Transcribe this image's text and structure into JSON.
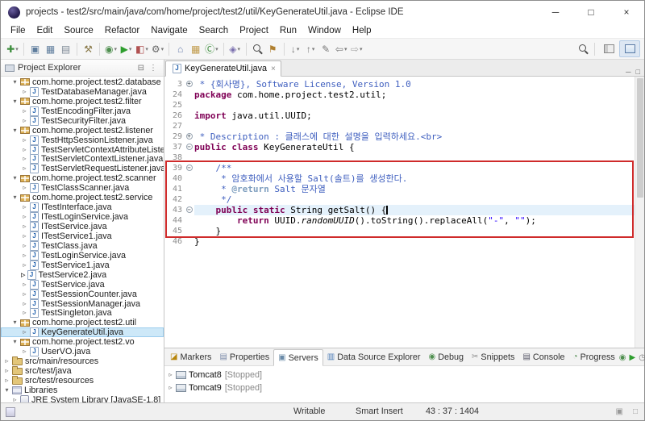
{
  "window": {
    "title": "projects - test2/src/main/java/com/home/project/test2/util/KeyGenerateUtil.java - Eclipse IDE",
    "controls": {
      "minimize": "─",
      "maximize": "□",
      "close": "×"
    }
  },
  "menubar": {
    "items": [
      "File",
      "Edit",
      "Source",
      "Refactor",
      "Navigate",
      "Search",
      "Project",
      "Run",
      "Window",
      "Help"
    ]
  },
  "icons": {
    "dropdown": "▾",
    "chevron_right": "▹",
    "chevron_down": "▾",
    "close": "×",
    "java_badge": "J",
    "fold_plus": "+",
    "fold_minus": "−",
    "collapse_all": "⊟",
    "view_menu": "⋮",
    "minimize": "─",
    "maximize": "□",
    "status_right_1": "▣",
    "status_right_2": "□"
  },
  "toolbar": {
    "buttons": [
      {
        "name": "new-wizard",
        "glyph": "✚",
        "color": "#3e8e3e"
      },
      {
        "name": "save",
        "glyph": "▣",
        "color": "#5f7d9d"
      },
      {
        "name": "save-all",
        "glyph": "▦",
        "color": "#5f7d9d"
      },
      {
        "name": "print",
        "glyph": "▤",
        "color": "#7f8a96"
      },
      {
        "name": "build-all",
        "glyph": "⚒",
        "color": "#8a7a4a"
      },
      {
        "name": "debug",
        "glyph": "◉",
        "color": "#4f8f4f"
      },
      {
        "name": "run",
        "glyph": "▶",
        "color": "#2e9e2e"
      },
      {
        "name": "coverage",
        "glyph": "◧",
        "color": "#b05050"
      },
      {
        "name": "external-tools",
        "glyph": "⚙",
        "color": "#666666"
      },
      {
        "name": "new-java-project",
        "glyph": "⌂",
        "color": "#6a7fae"
      },
      {
        "name": "new-package",
        "glyph": "▦",
        "color": "#c09a4a"
      },
      {
        "name": "new-class",
        "glyph": "Ⓒ",
        "color": "#3f8f3f"
      },
      {
        "name": "new-servlet",
        "glyph": "◈",
        "color": "#7a6fae"
      },
      {
        "name": "search",
        "glyph": "",
        "color": "#444444"
      },
      {
        "name": "mark-occurrences",
        "glyph": "⚑",
        "color": "#b08030"
      },
      {
        "name": "next-annotation",
        "glyph": "↓",
        "color": "#777777"
      },
      {
        "name": "prev-annotation",
        "glyph": "↑",
        "color": "#777777"
      },
      {
        "name": "last-edit-location",
        "glyph": "✎",
        "color": "#777777"
      },
      {
        "name": "back",
        "glyph": "⇦",
        "color": "#777777"
      },
      {
        "name": "forward",
        "glyph": "⇨",
        "color": "#aaaaaa"
      }
    ]
  },
  "explorer": {
    "title": "Project Explorer",
    "items": [
      {
        "label": "com.home.project.test2.database"
      },
      {
        "label": "TestDatabaseManager.java"
      },
      {
        "label": "com.home.project.test2.filter"
      },
      {
        "label": "TestEncodingFilter.java"
      },
      {
        "label": "TestSecurityFilter.java"
      },
      {
        "label": "com.home.project.test2.listener"
      },
      {
        "label": "TestHttpSessionListener.java"
      },
      {
        "label": "TestServletContextAttributeListener.java"
      },
      {
        "label": "TestServletContextListener.java"
      },
      {
        "label": "TestServletRequestListener.java"
      },
      {
        "label": "com.home.project.test2.scanner"
      },
      {
        "label": "TestClassScanner.java"
      },
      {
        "label": "com.home.project.test2.service"
      },
      {
        "label": "ITestInterface.java"
      },
      {
        "label": "ITestLoginService.java"
      },
      {
        "label": "ITestService.java"
      },
      {
        "label": "ITestService1.java"
      },
      {
        "label": "TestClass.java"
      },
      {
        "label": "TestLoginService.java"
      },
      {
        "label": "TestService1.java"
      },
      {
        "label": "TestService2.java"
      },
      {
        "label": "TestService.java"
      },
      {
        "label": "TestSessionCounter.java"
      },
      {
        "label": "TestSessionManager.java"
      },
      {
        "label": "TestSingleton.java"
      },
      {
        "label": "com.home.project.test2.util"
      },
      {
        "label": "KeyGenerateUtil.java",
        "selected": true
      },
      {
        "label": "com.home.project.test2.vo"
      },
      {
        "label": "UserVO.java"
      },
      {
        "label": "src/main/resources"
      },
      {
        "label": "src/test/java"
      },
      {
        "label": "src/test/resources"
      },
      {
        "label": "Libraries"
      },
      {
        "label": "JRE System Library [JavaSE-1.8]"
      }
    ]
  },
  "editor": {
    "tab": "KeyGenerateUtil.java",
    "lines": [
      {
        "num": "3",
        "fold": "plus",
        "segments": [
          {
            "c": "doc",
            "t": " * {회사명}, Software License, Version 1.0"
          }
        ]
      },
      {
        "num": "24",
        "segments": [
          {
            "c": "kw",
            "t": "package "
          },
          {
            "c": "pl",
            "t": "com.home.project.test2.util;"
          }
        ]
      },
      {
        "num": "25",
        "segments": []
      },
      {
        "num": "26",
        "segments": [
          {
            "c": "kw",
            "t": "import "
          },
          {
            "c": "pl",
            "t": "java.util.UUID;"
          }
        ]
      },
      {
        "num": "27",
        "segments": []
      },
      {
        "num": "29",
        "fold": "plus",
        "segments": [
          {
            "c": "doc",
            "t": " * Description : 클래스에 대한 설명을 입력하세요.<br>"
          }
        ]
      },
      {
        "num": "37",
        "fold": "minus",
        "segments": [
          {
            "c": "kw",
            "t": "public class "
          },
          {
            "c": "pl",
            "t": "KeyGenerateUtil {"
          }
        ]
      },
      {
        "num": "38",
        "segments": []
      },
      {
        "num": "39",
        "fold": "minus",
        "segments": [
          {
            "c": "doc",
            "t": "    /**"
          }
        ]
      },
      {
        "num": "40",
        "segments": [
          {
            "c": "doc",
            "t": "     * 암호화에서 사용할 Salt(솔트)를 생성한다."
          }
        ]
      },
      {
        "num": "41",
        "segments": [
          {
            "c": "doc",
            "t": "     * "
          },
          {
            "c": "dtag",
            "t": "@return"
          },
          {
            "c": "doc",
            "t": " Salt 문자열"
          }
        ]
      },
      {
        "num": "42",
        "segments": [
          {
            "c": "doc",
            "t": "     */"
          }
        ]
      },
      {
        "num": "43",
        "fold": "minus",
        "current": true,
        "segments": [
          {
            "c": "pl",
            "t": "    "
          },
          {
            "c": "kw",
            "t": "public static "
          },
          {
            "c": "pl",
            "t": "String getSalt() {"
          }
        ]
      },
      {
        "num": "44",
        "segments": [
          {
            "c": "pl",
            "t": "        "
          },
          {
            "c": "kw",
            "t": "return "
          },
          {
            "c": "pl",
            "t": "UUID."
          },
          {
            "c": "sm",
            "t": "randomUUID"
          },
          {
            "c": "pl",
            "t": "().toString().replaceAll("
          },
          {
            "c": "str",
            "t": "\"-\""
          },
          {
            "c": "pl",
            "t": ", "
          },
          {
            "c": "str",
            "t": "\"\""
          },
          {
            "c": "pl",
            "t": ");"
          }
        ]
      },
      {
        "num": "45",
        "segments": [
          {
            "c": "pl",
            "t": "    }"
          }
        ]
      },
      {
        "num": "46",
        "segments": [
          {
            "c": "pl",
            "t": "}"
          }
        ]
      }
    ]
  },
  "bottom_panel": {
    "tabs": [
      {
        "label": "Markers",
        "icon": "◪",
        "color": "#b8860b"
      },
      {
        "label": "Properties",
        "icon": "▤",
        "color": "#7a8aa8"
      },
      {
        "label": "Servers",
        "icon": "▣",
        "color": "#6a8aa8",
        "selected": true
      },
      {
        "label": "Data Source Explorer",
        "icon": "▥",
        "color": "#4a7ab5"
      },
      {
        "label": "Debug",
        "icon": "◉",
        "color": "#4f8f4f"
      },
      {
        "label": "Snippets",
        "icon": "✂",
        "color": "#888888"
      },
      {
        "label": "Console",
        "icon": "▤",
        "color": "#555566"
      },
      {
        "label": "Progress",
        "icon": "◔",
        "color": "#4a8a4a"
      }
    ],
    "view_toolbar": [
      {
        "name": "debug-server",
        "glyph": "◉",
        "color": "#4f8f4f"
      },
      {
        "name": "start-server",
        "glyph": "▶",
        "color": "#2e9e2e"
      },
      {
        "name": "profile-server",
        "glyph": "◷",
        "color": "#777777"
      },
      {
        "name": "stop-server",
        "glyph": "■",
        "color": "#c03030"
      },
      {
        "name": "publish-server",
        "glyph": "↑",
        "color": "#666666"
      },
      {
        "name": "clean-server",
        "glyph": "↻",
        "color": "#666666"
      }
    ]
  },
  "servers": {
    "items": [
      {
        "name": "Tomcat8",
        "status": "[Stopped]"
      },
      {
        "name": "Tomcat9",
        "status": "[Stopped]"
      }
    ]
  },
  "statusbar": {
    "writable": "Writable",
    "insert_mode": "Smart Insert",
    "position": "43 : 37 : 1404"
  },
  "colors": {
    "keyword": "#7f0055",
    "javadoc": "#3f5fbf",
    "javadoc_tag": "#7f9fbf",
    "string": "#2a00ff",
    "current_line": "#e4f1fb",
    "selection": "#cde8f8",
    "highlight_box": "#cf2b2b",
    "accent": "#2161ae"
  }
}
